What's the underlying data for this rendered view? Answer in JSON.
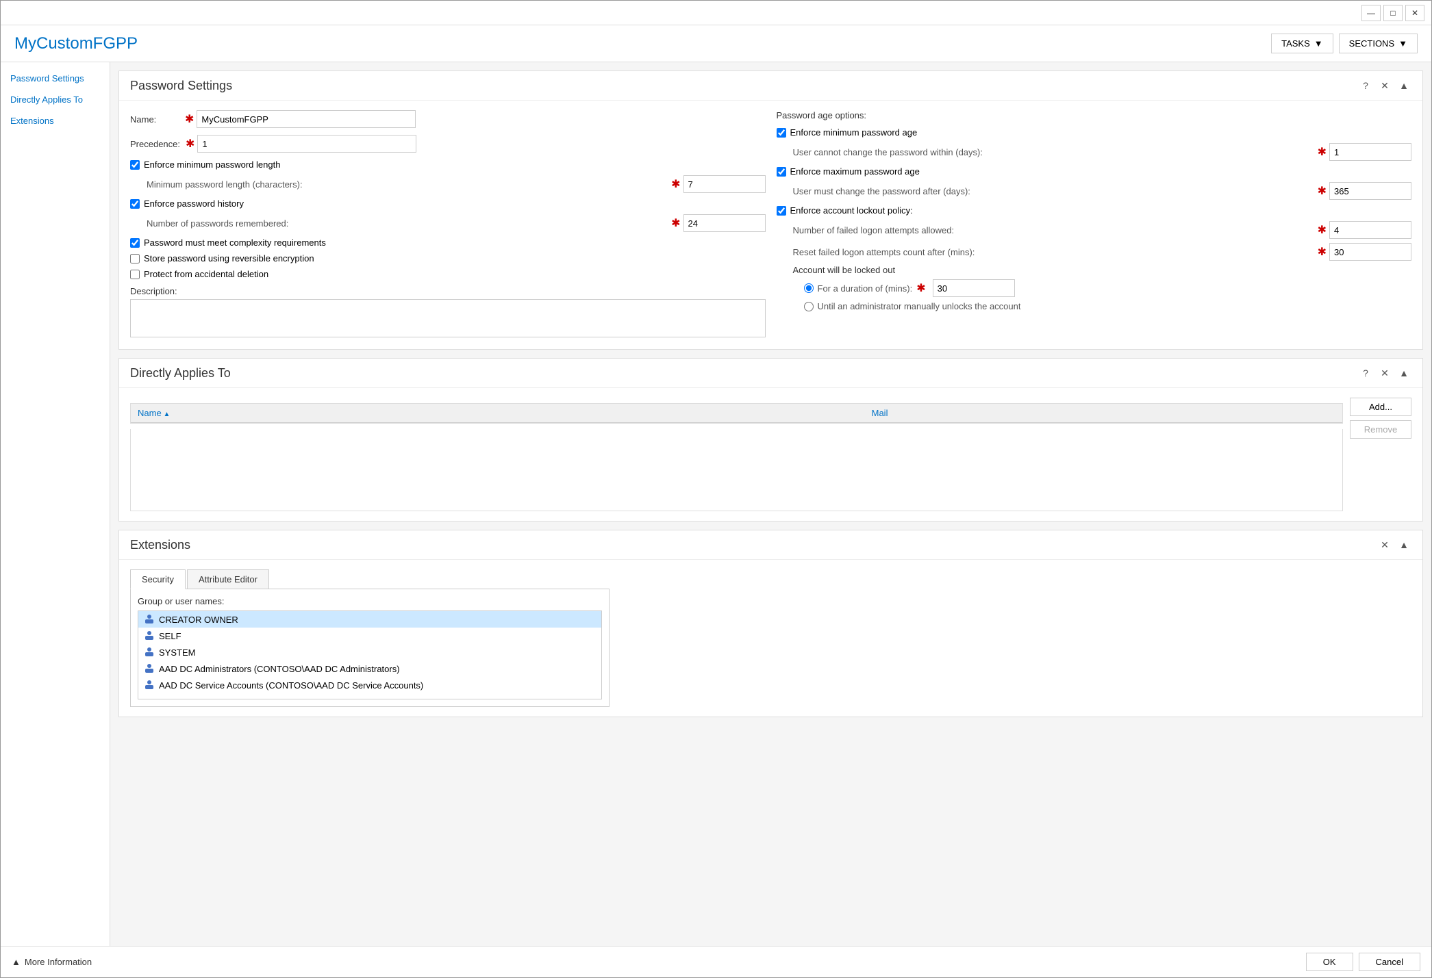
{
  "window": {
    "title_btn_min": "—",
    "title_btn_max": "□",
    "title_btn_close": "✕"
  },
  "header": {
    "app_title": "MyCustomFGPP",
    "tasks_btn": "TASKS",
    "sections_btn": "SECTIONS"
  },
  "sidebar": {
    "items": [
      {
        "label": "Password Settings",
        "id": "password-settings"
      },
      {
        "label": "Directly Applies To",
        "id": "directly-applies-to"
      },
      {
        "label": "Extensions",
        "id": "extensions"
      }
    ]
  },
  "password_settings": {
    "section_title": "Password Settings",
    "name_label": "Name:",
    "name_value": "MyCustomFGPP",
    "precedence_label": "Precedence:",
    "precedence_value": "1",
    "enforce_min_length_label": "Enforce minimum password length",
    "min_length_label": "Minimum password length (characters):",
    "min_length_value": "7",
    "enforce_history_label": "Enforce password history",
    "history_label": "Number of passwords remembered:",
    "history_value": "24",
    "complexity_label": "Password must meet complexity requirements",
    "reversible_label": "Store password using reversible encryption",
    "protect_label": "Protect from accidental deletion",
    "description_label": "Description:",
    "description_value": "",
    "password_age_title": "Password age options:",
    "enforce_min_age_label": "Enforce minimum password age",
    "min_age_sub": "User cannot change the password within (days):",
    "min_age_value": "1",
    "enforce_max_age_label": "Enforce maximum password age",
    "max_age_sub": "User must change the password after (days):",
    "max_age_value": "365",
    "enforce_lockout_label": "Enforce account lockout policy:",
    "failed_attempts_label": "Number of failed logon attempts allowed:",
    "failed_attempts_value": "4",
    "reset_label": "Reset failed logon attempts count after (mins):",
    "reset_value": "30",
    "lockout_title": "Account will be locked out",
    "duration_label": "For a duration of (mins):",
    "duration_value": "30",
    "manual_label": "Until an administrator manually unlocks the account"
  },
  "directly_applies_to": {
    "section_title": "Directly Applies To",
    "col_name": "Name",
    "col_mail": "Mail",
    "add_btn": "Add...",
    "remove_btn": "Remove",
    "rows": []
  },
  "extensions": {
    "section_title": "Extensions",
    "tab_security": "Security",
    "tab_attribute_editor": "Attribute Editor",
    "group_users_label": "Group or user names:",
    "users": [
      {
        "label": "CREATOR OWNER",
        "selected": true
      },
      {
        "label": "SELF",
        "selected": false
      },
      {
        "label": "SYSTEM",
        "selected": false
      },
      {
        "label": "AAD DC Administrators (CONTOSO\\AAD DC Administrators)",
        "selected": false
      },
      {
        "label": "AAD DC Service Accounts (CONTOSO\\AAD DC Service Accounts)",
        "selected": false
      }
    ]
  },
  "footer": {
    "more_info": "More Information",
    "ok_btn": "OK",
    "cancel_btn": "Cancel"
  }
}
